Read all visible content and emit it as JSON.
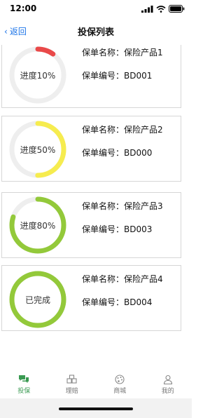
{
  "status": {
    "time": "12:00"
  },
  "nav": {
    "back_label": "返回",
    "title": "投保列表"
  },
  "policies": [
    {
      "name_label": "保单名称：",
      "name": "保险产品1",
      "code_label": "保单编号：",
      "code": "BD001",
      "ring_text": "进度10%",
      "progress": 0.1,
      "color": "#e94949"
    },
    {
      "name_label": "保单名称：",
      "name": "保险产品2",
      "code_label": "保单编号：",
      "code": "BD000",
      "ring_text": "进度50%",
      "progress": 0.5,
      "color": "#f6ec4f"
    },
    {
      "name_label": "保单名称：",
      "name": "保险产品3",
      "code_label": "保单编号：",
      "code": "BD003",
      "ring_text": "进度80%",
      "progress": 0.8,
      "color": "#93c93a"
    },
    {
      "name_label": "保单名称：",
      "name": "保险产品4",
      "code_label": "保单编号：",
      "code": "BD004",
      "ring_text": "已完成",
      "progress": 1.0,
      "color": "#93c93a"
    }
  ],
  "tabs": [
    {
      "label": "投保",
      "icon": "chat-bubbles-icon",
      "active": true
    },
    {
      "label": "理赔",
      "icon": "blocks-icon",
      "active": false
    },
    {
      "label": "商城",
      "icon": "palette-icon",
      "active": false
    },
    {
      "label": "我的",
      "icon": "person-icon",
      "active": false
    }
  ],
  "colors": {
    "accent": "#3a9a52",
    "link": "#1a73e8",
    "track": "#eeeeee"
  }
}
